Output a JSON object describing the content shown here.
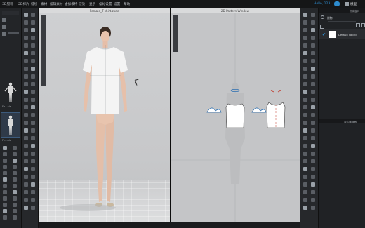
{
  "menubar": {
    "items": [
      "3D服装",
      "2D样片",
      "缝纫",
      "素材",
      "编辑素材",
      "虚拟模特",
      "渲染",
      "显示",
      "偏好设置",
      "设置",
      "帮助"
    ],
    "user": "Hello, 123",
    "mode_label": "模型"
  },
  "window_3d": {
    "title": "Female_T-shirt.zpac"
  },
  "window_2d": {
    "title": "2D Pattern Window"
  },
  "object_browser": {
    "title": "物体窗口",
    "tab_label": "织物",
    "fabric_item": "Default Fabric",
    "property_title": "属性编辑器"
  },
  "library": {
    "avatar_label_1": "Fe...ale",
    "avatar_label_2": "Fe...ale"
  },
  "colors": {
    "accent": "#2d8ccf",
    "panel": "#232528",
    "viewport_3d": "#cfd0d2",
    "viewport_2d": "#c4c5c7"
  }
}
